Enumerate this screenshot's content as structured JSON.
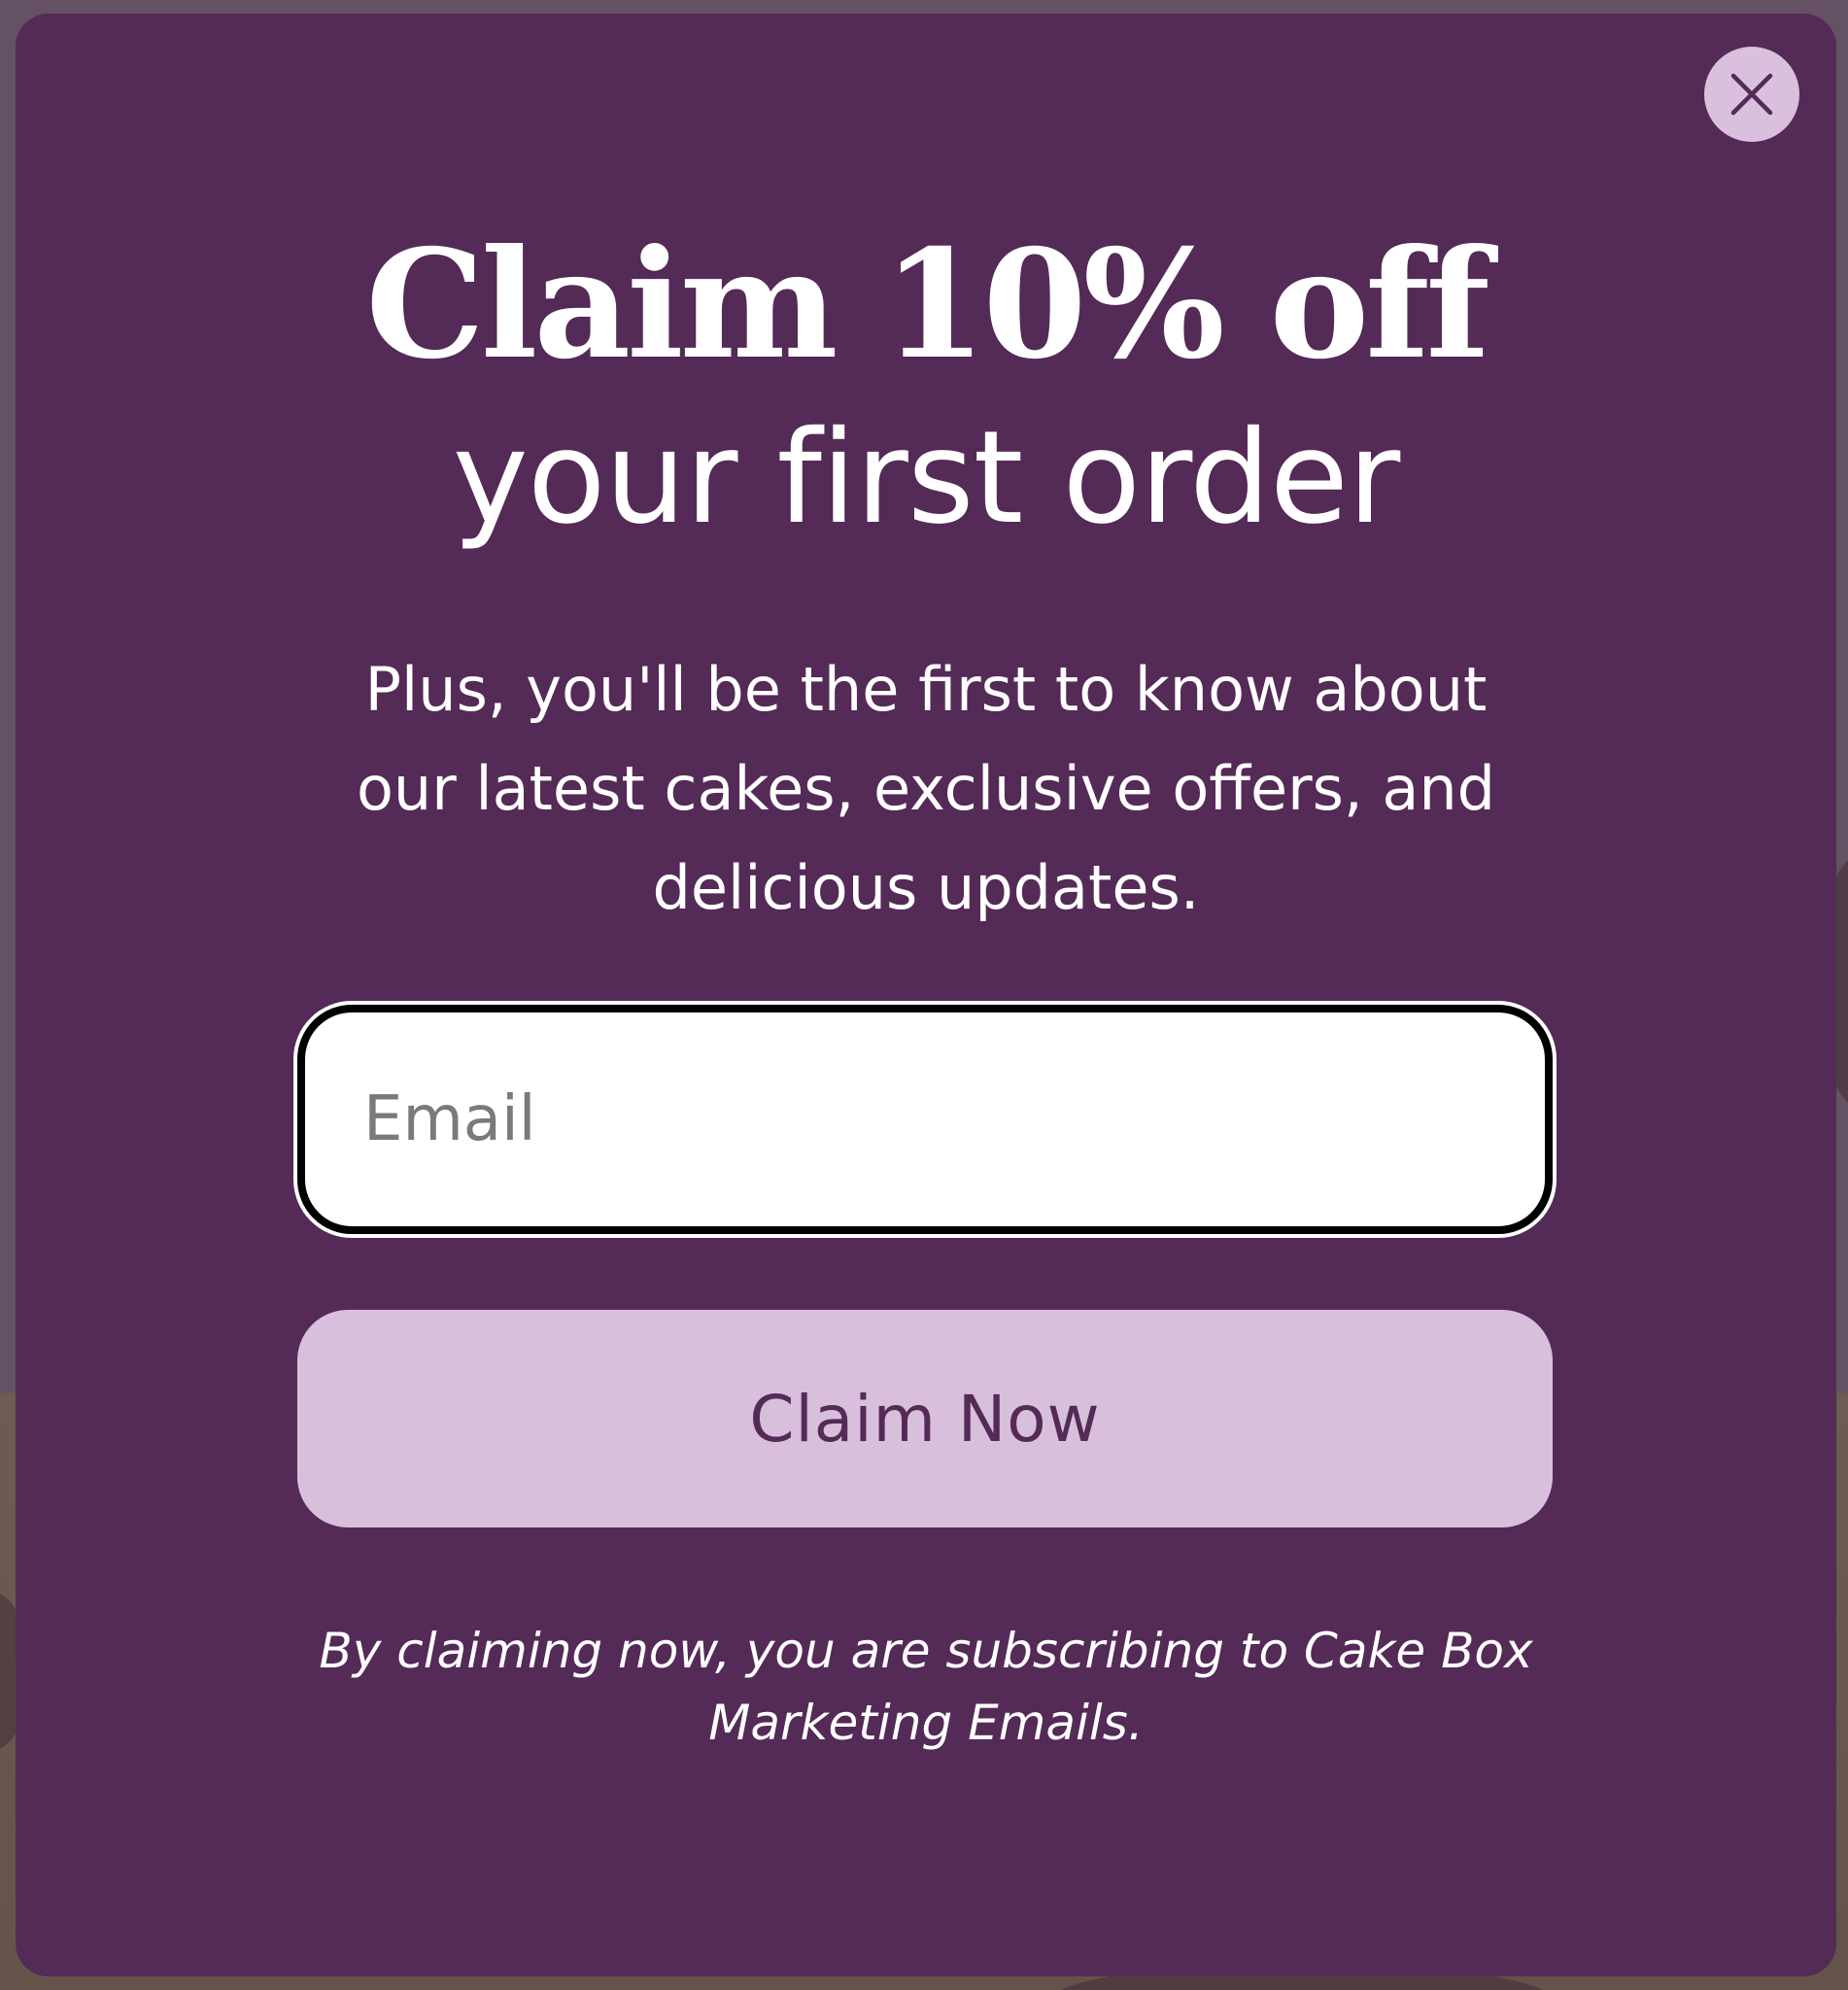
{
  "popup": {
    "close_icon": "close-icon",
    "headline_line1": "Claim 10% off",
    "headline_line2": "your first order",
    "subtext": "Plus, you'll be the first to know about our latest cakes, exclusive offers, and delicious updates.",
    "email_placeholder": "Email",
    "email_value": "",
    "claim_button_label": "Claim Now",
    "disclaimer": "By claiming now, you are subscribing to Cake Box Marketing Emails."
  },
  "colors": {
    "modal_background": "#542a57",
    "accent_button": "#d8bfdc",
    "button_text": "#542a57",
    "text": "#ffffff"
  }
}
